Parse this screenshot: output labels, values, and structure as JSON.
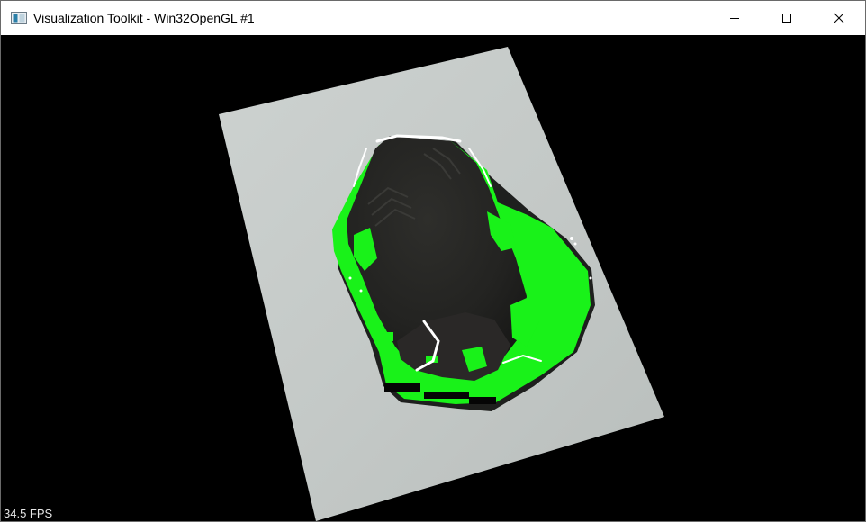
{
  "window": {
    "title": "Visualization Toolkit - Win32OpenGL #1",
    "icons": {
      "app": "vtk-window-icon",
      "minimize": "minimize-icon",
      "maximize": "maximize-icon",
      "close": "close-icon"
    }
  },
  "viewport": {
    "fps_label": "34.5 FPS",
    "colors": {
      "background": "#000000",
      "paper": "#c9cecc",
      "object_dark": "#242422",
      "highlight_green": "#19f219",
      "edge_white": "#ffffff"
    }
  }
}
